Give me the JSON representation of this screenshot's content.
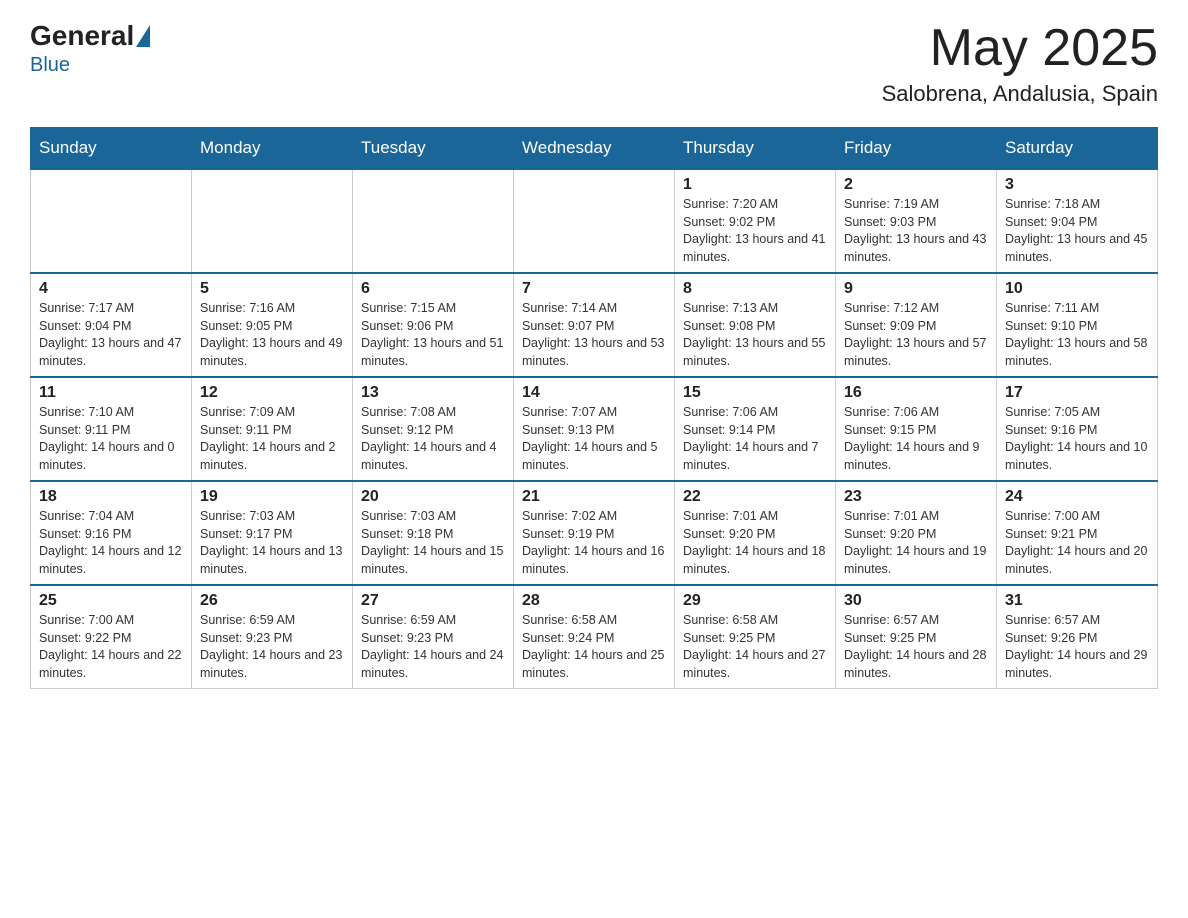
{
  "header": {
    "logo_general": "General",
    "logo_blue": "Blue",
    "month_year": "May 2025",
    "location": "Salobrena, Andalusia, Spain"
  },
  "days_of_week": [
    "Sunday",
    "Monday",
    "Tuesday",
    "Wednesday",
    "Thursday",
    "Friday",
    "Saturday"
  ],
  "weeks": [
    [
      {
        "day": "",
        "info": ""
      },
      {
        "day": "",
        "info": ""
      },
      {
        "day": "",
        "info": ""
      },
      {
        "day": "",
        "info": ""
      },
      {
        "day": "1",
        "info": "Sunrise: 7:20 AM\nSunset: 9:02 PM\nDaylight: 13 hours and 41 minutes."
      },
      {
        "day": "2",
        "info": "Sunrise: 7:19 AM\nSunset: 9:03 PM\nDaylight: 13 hours and 43 minutes."
      },
      {
        "day": "3",
        "info": "Sunrise: 7:18 AM\nSunset: 9:04 PM\nDaylight: 13 hours and 45 minutes."
      }
    ],
    [
      {
        "day": "4",
        "info": "Sunrise: 7:17 AM\nSunset: 9:04 PM\nDaylight: 13 hours and 47 minutes."
      },
      {
        "day": "5",
        "info": "Sunrise: 7:16 AM\nSunset: 9:05 PM\nDaylight: 13 hours and 49 minutes."
      },
      {
        "day": "6",
        "info": "Sunrise: 7:15 AM\nSunset: 9:06 PM\nDaylight: 13 hours and 51 minutes."
      },
      {
        "day": "7",
        "info": "Sunrise: 7:14 AM\nSunset: 9:07 PM\nDaylight: 13 hours and 53 minutes."
      },
      {
        "day": "8",
        "info": "Sunrise: 7:13 AM\nSunset: 9:08 PM\nDaylight: 13 hours and 55 minutes."
      },
      {
        "day": "9",
        "info": "Sunrise: 7:12 AM\nSunset: 9:09 PM\nDaylight: 13 hours and 57 minutes."
      },
      {
        "day": "10",
        "info": "Sunrise: 7:11 AM\nSunset: 9:10 PM\nDaylight: 13 hours and 58 minutes."
      }
    ],
    [
      {
        "day": "11",
        "info": "Sunrise: 7:10 AM\nSunset: 9:11 PM\nDaylight: 14 hours and 0 minutes."
      },
      {
        "day": "12",
        "info": "Sunrise: 7:09 AM\nSunset: 9:11 PM\nDaylight: 14 hours and 2 minutes."
      },
      {
        "day": "13",
        "info": "Sunrise: 7:08 AM\nSunset: 9:12 PM\nDaylight: 14 hours and 4 minutes."
      },
      {
        "day": "14",
        "info": "Sunrise: 7:07 AM\nSunset: 9:13 PM\nDaylight: 14 hours and 5 minutes."
      },
      {
        "day": "15",
        "info": "Sunrise: 7:06 AM\nSunset: 9:14 PM\nDaylight: 14 hours and 7 minutes."
      },
      {
        "day": "16",
        "info": "Sunrise: 7:06 AM\nSunset: 9:15 PM\nDaylight: 14 hours and 9 minutes."
      },
      {
        "day": "17",
        "info": "Sunrise: 7:05 AM\nSunset: 9:16 PM\nDaylight: 14 hours and 10 minutes."
      }
    ],
    [
      {
        "day": "18",
        "info": "Sunrise: 7:04 AM\nSunset: 9:16 PM\nDaylight: 14 hours and 12 minutes."
      },
      {
        "day": "19",
        "info": "Sunrise: 7:03 AM\nSunset: 9:17 PM\nDaylight: 14 hours and 13 minutes."
      },
      {
        "day": "20",
        "info": "Sunrise: 7:03 AM\nSunset: 9:18 PM\nDaylight: 14 hours and 15 minutes."
      },
      {
        "day": "21",
        "info": "Sunrise: 7:02 AM\nSunset: 9:19 PM\nDaylight: 14 hours and 16 minutes."
      },
      {
        "day": "22",
        "info": "Sunrise: 7:01 AM\nSunset: 9:20 PM\nDaylight: 14 hours and 18 minutes."
      },
      {
        "day": "23",
        "info": "Sunrise: 7:01 AM\nSunset: 9:20 PM\nDaylight: 14 hours and 19 minutes."
      },
      {
        "day": "24",
        "info": "Sunrise: 7:00 AM\nSunset: 9:21 PM\nDaylight: 14 hours and 20 minutes."
      }
    ],
    [
      {
        "day": "25",
        "info": "Sunrise: 7:00 AM\nSunset: 9:22 PM\nDaylight: 14 hours and 22 minutes."
      },
      {
        "day": "26",
        "info": "Sunrise: 6:59 AM\nSunset: 9:23 PM\nDaylight: 14 hours and 23 minutes."
      },
      {
        "day": "27",
        "info": "Sunrise: 6:59 AM\nSunset: 9:23 PM\nDaylight: 14 hours and 24 minutes."
      },
      {
        "day": "28",
        "info": "Sunrise: 6:58 AM\nSunset: 9:24 PM\nDaylight: 14 hours and 25 minutes."
      },
      {
        "day": "29",
        "info": "Sunrise: 6:58 AM\nSunset: 9:25 PM\nDaylight: 14 hours and 27 minutes."
      },
      {
        "day": "30",
        "info": "Sunrise: 6:57 AM\nSunset: 9:25 PM\nDaylight: 14 hours and 28 minutes."
      },
      {
        "day": "31",
        "info": "Sunrise: 6:57 AM\nSunset: 9:26 PM\nDaylight: 14 hours and 29 minutes."
      }
    ]
  ]
}
